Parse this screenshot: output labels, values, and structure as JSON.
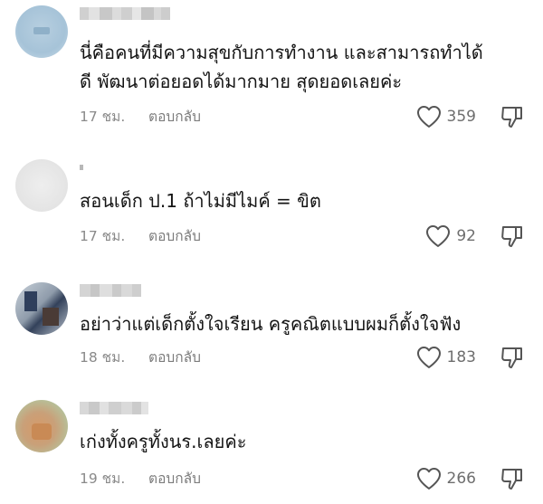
{
  "comments": [
    {
      "text_lines": [
        "นี่คือคนที่มีความสุขกับการทำงาน และสามารถทำได้",
        "ดี พัฒนาต่อยอดได้มากมาย สุดยอดเลยค่ะ"
      ],
      "time": "17 ชม.",
      "reply_label": "ตอบกลับ",
      "likes": "359",
      "avatar_colors": [
        "#a9c7dc",
        "#c2d7e5"
      ]
    },
    {
      "text_lines": [
        "สอนเด็ก ป.1 ถ้าไม่มีไมค์ = ขิต"
      ],
      "time": "17 ชม.",
      "reply_label": "ตอบกลับ",
      "likes": "92",
      "avatar_colors": [
        "#e6e6e6",
        "#f0f0f0"
      ]
    },
    {
      "text_lines": [
        "อย่าว่าแต่เด็กตั้งใจเรียน ครูคณิตแบบผมก็ตั้งใจฟัง"
      ],
      "time": "18 ชม.",
      "reply_label": "ตอบกลับ",
      "likes": "183",
      "avatar_colors": [
        "#3b4f6e",
        "#9aa4b0"
      ]
    },
    {
      "text_lines": [
        "เก่งทั้งครูทั้งนร.เลยค่ะ"
      ],
      "time": "19 ชม.",
      "reply_label": "ตอบกลับ",
      "likes": "266",
      "avatar_colors": [
        "#d9a373",
        "#a9b98c"
      ]
    }
  ]
}
